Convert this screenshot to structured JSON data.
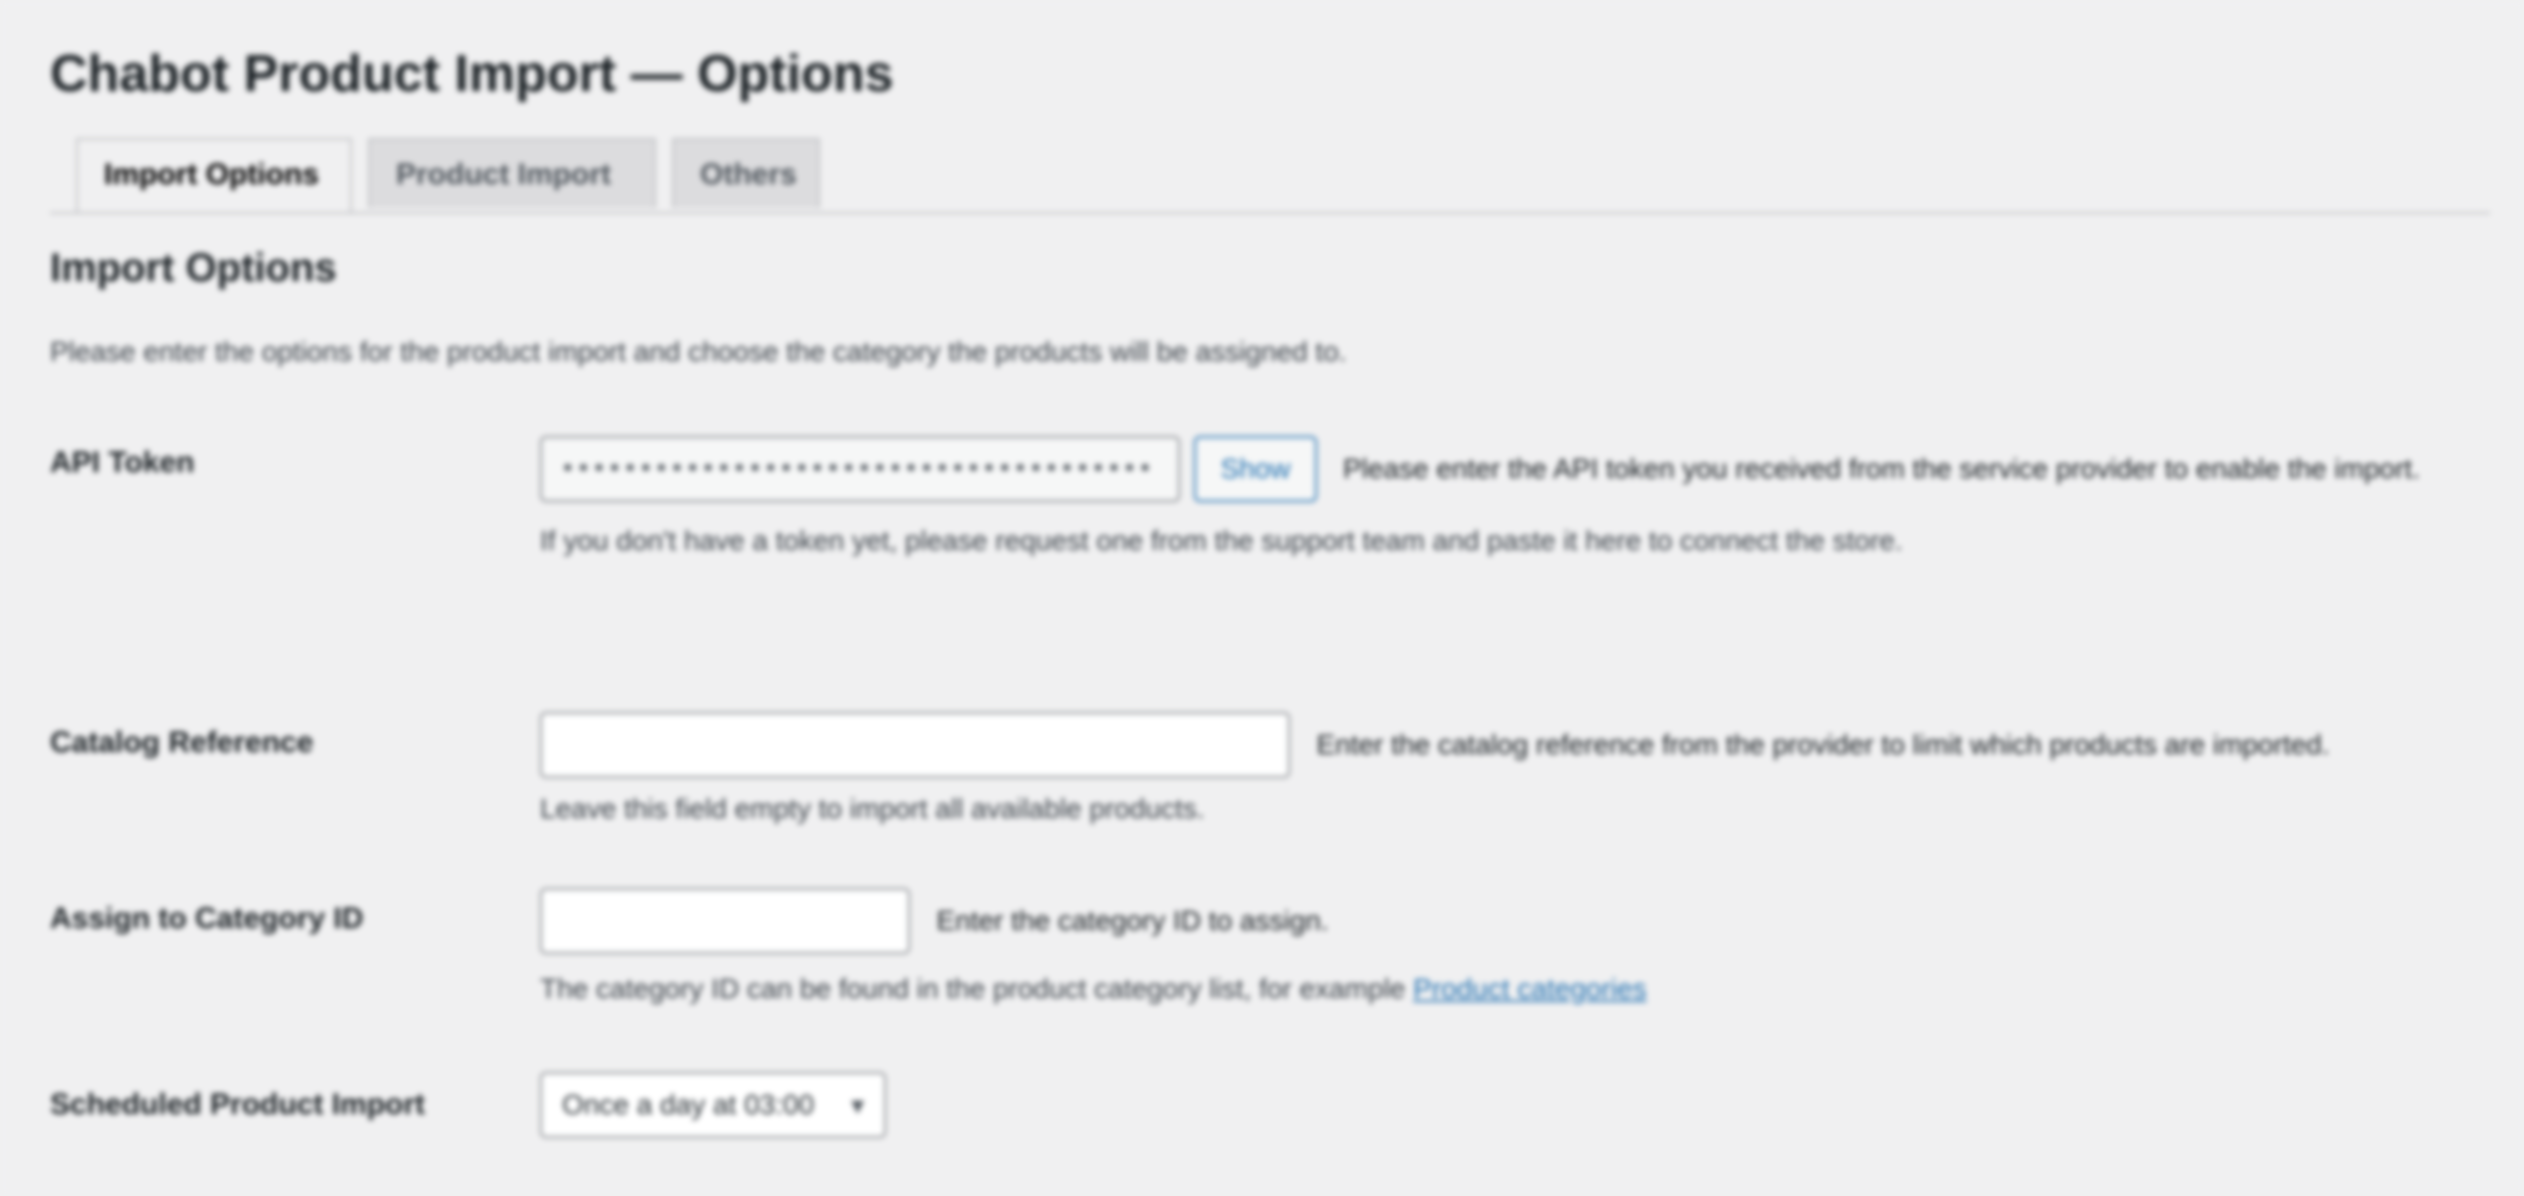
{
  "page": {
    "title": "Chabot Product Import — Options"
  },
  "tabs": [
    {
      "label": "Import Options",
      "active": true
    },
    {
      "label": "Product Import",
      "active": false
    },
    {
      "label": "Others",
      "active": false
    }
  ],
  "section": {
    "title": "Import Options",
    "description": "Please enter the options for the product import and choose the category the products will be assigned to."
  },
  "rows": {
    "api_token": {
      "label": "API Token",
      "value": "••••••••••••••••••••••••••••••••••••••",
      "button": "Show",
      "inline_desc": "Please enter the API token you received from the service provider to enable the import.",
      "desc": "If you don't have a token yet, please request one from the support team and paste it here to connect the store."
    },
    "catalog_reference": {
      "label": "Catalog Reference",
      "value": "",
      "inline_desc": "Enter the catalog reference from the provider to limit which products are imported.",
      "desc": "Leave this field empty to import all available products."
    },
    "category_id": {
      "label": "Assign to Category ID",
      "value": "",
      "inline_desc": "Enter the category ID to assign.",
      "desc_prefix": "The category ID can be found in the product category list, for example ",
      "desc_link": "Product categories"
    },
    "scheduled_import": {
      "label": "Scheduled Product Import",
      "selected": "Once a day at 03:00",
      "chevron_icon": "chevron-down-icon"
    }
  },
  "colors": {
    "background": "#f0f0f1",
    "accent": "#2271b1",
    "text": "#1d2327"
  }
}
